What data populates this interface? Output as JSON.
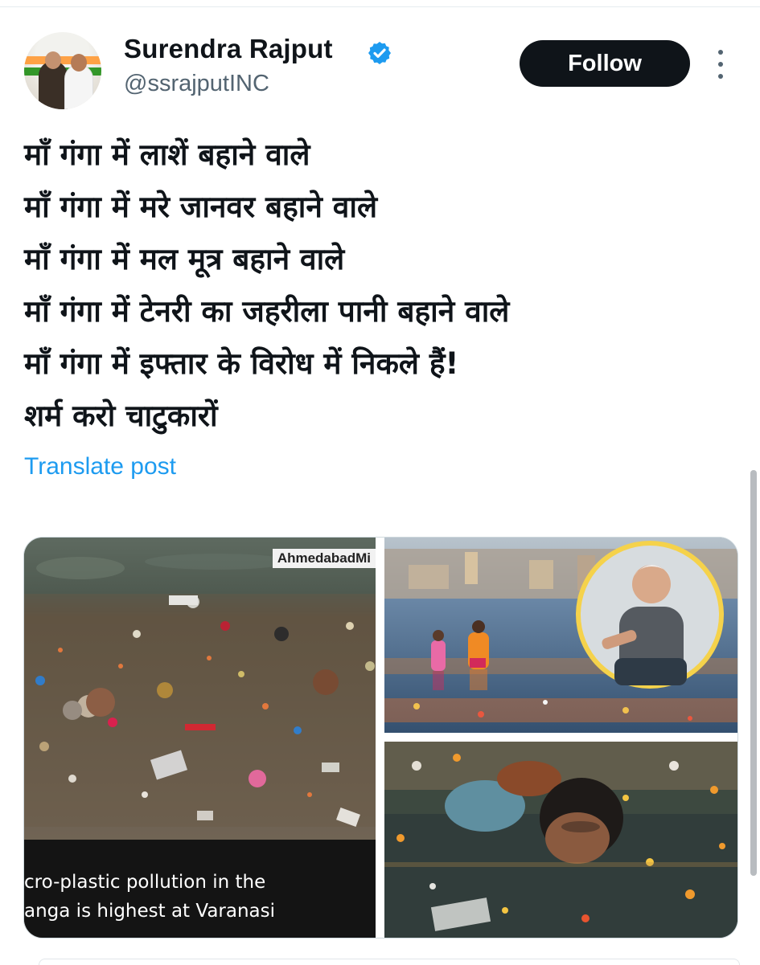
{
  "author": {
    "name": "Surendra Rajput",
    "handle": "@ssrajputINC",
    "verified": true
  },
  "follow_label": "Follow",
  "post": {
    "lines": [
      "माँ गंगा में लाशें बहाने वाले",
      "माँ गंगा में मरे जानवर बहाने वाले",
      "माँ गंगा में मल मूत्र बहाने वाले",
      "माँ गंगा में टेनरी का जहरीला पानी बहाने वाले",
      "माँ गंगा में इफ्तार के विरोध में निकले हैं!",
      "शर्म करो चाटुकारों"
    ],
    "translate_label": "Translate post"
  },
  "media": {
    "watermark": "AhmedabadMi",
    "caption_line1": "cro-plastic pollution in the",
    "caption_line2": "anga is highest at Varanasi"
  },
  "icons": {
    "verified": "verified-badge-icon",
    "more": "more-options-icon"
  },
  "colors": {
    "link": "#1d9bf0",
    "follow_bg": "#0f1419",
    "secondary_text": "#536471",
    "verified": "#1d9bf0"
  }
}
